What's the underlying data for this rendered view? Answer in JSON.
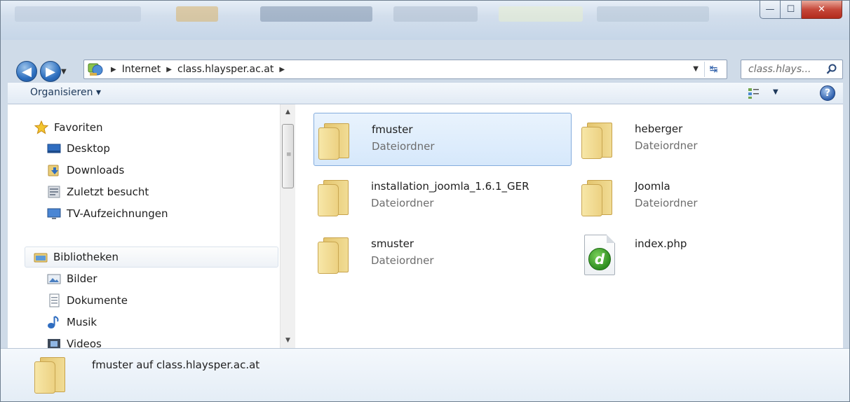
{
  "window": {
    "buttons": {
      "minimize": "—",
      "maximize": "☐",
      "close": "✕"
    }
  },
  "address": {
    "crumbs": [
      "Internet",
      "class.hlaysper.ac.at"
    ],
    "search_placeholder": "class.hlays..."
  },
  "toolbar": {
    "organise_label": "Organisieren ▾",
    "help_label": "?"
  },
  "navpane": {
    "favorites_label": "Favoriten",
    "favorites": [
      "Desktop",
      "Downloads",
      "Zuletzt besucht",
      "TV-Aufzeichnungen"
    ],
    "libraries_label": "Bibliotheken",
    "libraries": [
      "Bilder",
      "Dokumente",
      "Musik",
      "Videos"
    ]
  },
  "files": [
    {
      "name": "fmuster",
      "type": "Dateiordner",
      "icon": "folder-icon",
      "selected": true
    },
    {
      "name": "heberger",
      "type": "Dateiordner",
      "icon": "folder-icon"
    },
    {
      "name": "installation_joomla_1.6.1_GER",
      "type": "Dateiordner",
      "icon": "folder-icon"
    },
    {
      "name": "Joomla",
      "type": "Dateiordner",
      "icon": "folder-icon"
    },
    {
      "name": "smuster",
      "type": "Dateiordner",
      "icon": "folder-icon"
    },
    {
      "name": "index.php",
      "type": "",
      "icon": "php-file-icon"
    }
  ],
  "details": {
    "text": "fmuster auf class.hlaysper.ac.at"
  },
  "colors": {
    "selection_bg": "#d6e8fb",
    "selection_border": "#84acdd",
    "chrome": "#cfdbe8"
  }
}
